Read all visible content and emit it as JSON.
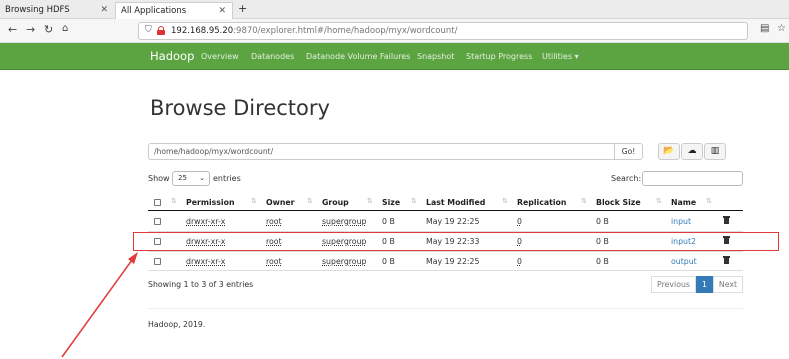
{
  "browser": {
    "tabs": [
      {
        "label": "Browsing HDFS",
        "active": false
      },
      {
        "label": "All Applications",
        "active": true
      }
    ],
    "new_tab": "+",
    "url_host": "192.168.95.20",
    "url_rest": ":9870/explorer.html#/home/hadoop/myx/wordcount/"
  },
  "navbar": {
    "brand": "Hadoop",
    "items": [
      "Overview",
      "Datanodes",
      "Datanode Volume Failures",
      "Snapshot",
      "Startup Progress",
      "Utilities ▾"
    ]
  },
  "page": {
    "title": "Browse Directory",
    "path_value": "/home/hadoop/myx/wordcount/",
    "go_label": "Go!",
    "show_label": "Show",
    "page_size": "25",
    "entries_label": "entries",
    "search_label": "Search:"
  },
  "table": {
    "headers": [
      "Permission",
      "Owner",
      "Group",
      "Size",
      "Last Modified",
      "Replication",
      "Block Size",
      "Name"
    ],
    "rows": [
      {
        "permission": "drwxr-xr-x",
        "owner": "root",
        "group": "supergroup",
        "size": "0 B",
        "modified": "May 19 22:25",
        "replication": "0",
        "block_size": "0 B",
        "name": "input"
      },
      {
        "permission": "drwxr-xr-x",
        "owner": "root",
        "group": "supergroup",
        "size": "0 B",
        "modified": "May 19 22:33",
        "replication": "0",
        "block_size": "0 B",
        "name": "input2"
      },
      {
        "permission": "drwxr-xr-x",
        "owner": "root",
        "group": "supergroup",
        "size": "0 B",
        "modified": "May 19 22:25",
        "replication": "0",
        "block_size": "0 B",
        "name": "output"
      }
    ],
    "info": "Showing 1 to 3 of 3 entries"
  },
  "pagination": {
    "previous": "Previous",
    "current": "1",
    "next": "Next"
  },
  "footer": "Hadoop, 2019.",
  "colors": {
    "hadoop_green": "#5ca442",
    "link_blue": "#337ab7",
    "highlight_red": "#e03a3a"
  }
}
